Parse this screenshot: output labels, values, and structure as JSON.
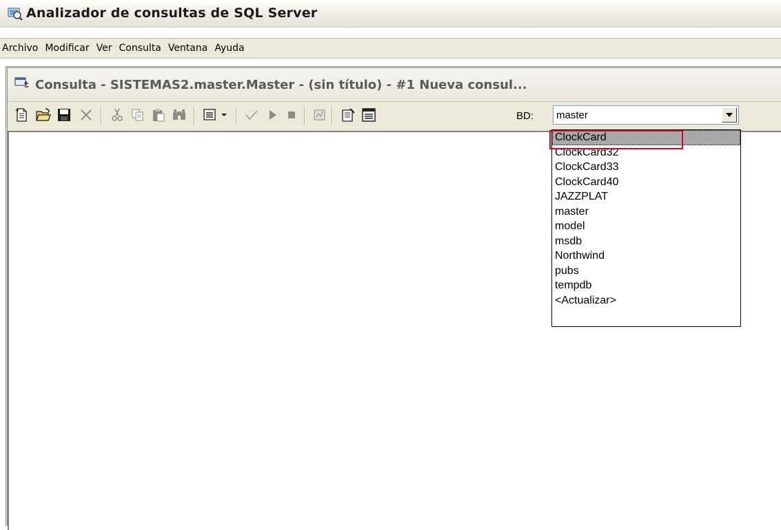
{
  "app": {
    "title": "Analizador de consultas de SQL Server",
    "icon": "query-analyzer-icon"
  },
  "menu": [
    {
      "label": "Archivo"
    },
    {
      "label": "Modificar"
    },
    {
      "label": "Ver"
    },
    {
      "label": "Consulta"
    },
    {
      "label": "Ventana"
    },
    {
      "label": "Ayuda"
    }
  ],
  "query_window": {
    "title": "Consulta - SISTEMAS2.master.Master - (sin título) - #1 Nueva consul...",
    "icon": "query-window-icon"
  },
  "toolbar": {
    "buttons": [
      "new-query-icon",
      "open-folder-icon",
      "save-icon",
      "clear-icon",
      "cut-icon",
      "copy-icon",
      "paste-icon",
      "find-icon",
      "results-mode-icon",
      "check-syntax-icon",
      "execute-icon",
      "stop-icon",
      "show-plan-icon",
      "object-browser-icon",
      "properties-icon"
    ],
    "db_label": "BD:",
    "db_selected": "master"
  },
  "db_dropdown": {
    "options": [
      "ClockCard",
      "ClockCard32",
      "ClockCard33",
      "ClockCard40",
      "JAZZPLAT",
      "master",
      "model",
      "msdb",
      "Northwind",
      "pubs",
      "tempdb",
      "<Actualizar>"
    ],
    "highlighted_index": 0
  },
  "colors": {
    "highlight_box": "#e3001b",
    "selected_bg": "#a9a9a9",
    "window_bg": "#ece9d8"
  }
}
